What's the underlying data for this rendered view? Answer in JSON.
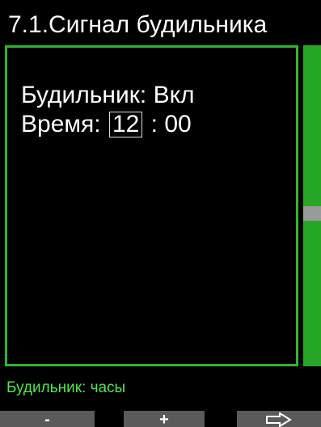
{
  "header": {
    "title": "7.1.Сигнал будильника"
  },
  "settings": {
    "alarm_label": "Будильник:",
    "alarm_value": "Вкл",
    "time_label": "Время:",
    "time_hours": "12",
    "time_separator": ":",
    "time_minutes": "00"
  },
  "status": {
    "text": "Будильник: часы"
  },
  "softkeys": {
    "minus_label": "-",
    "plus_label": "+",
    "next_icon": "arrow-right-outline-icon"
  },
  "colors": {
    "accent_green": "#2fb52f",
    "status_text_green": "#4be84b",
    "softkey_gray": "#5a5a5a",
    "scroll_thumb": "#9a9a9a"
  }
}
